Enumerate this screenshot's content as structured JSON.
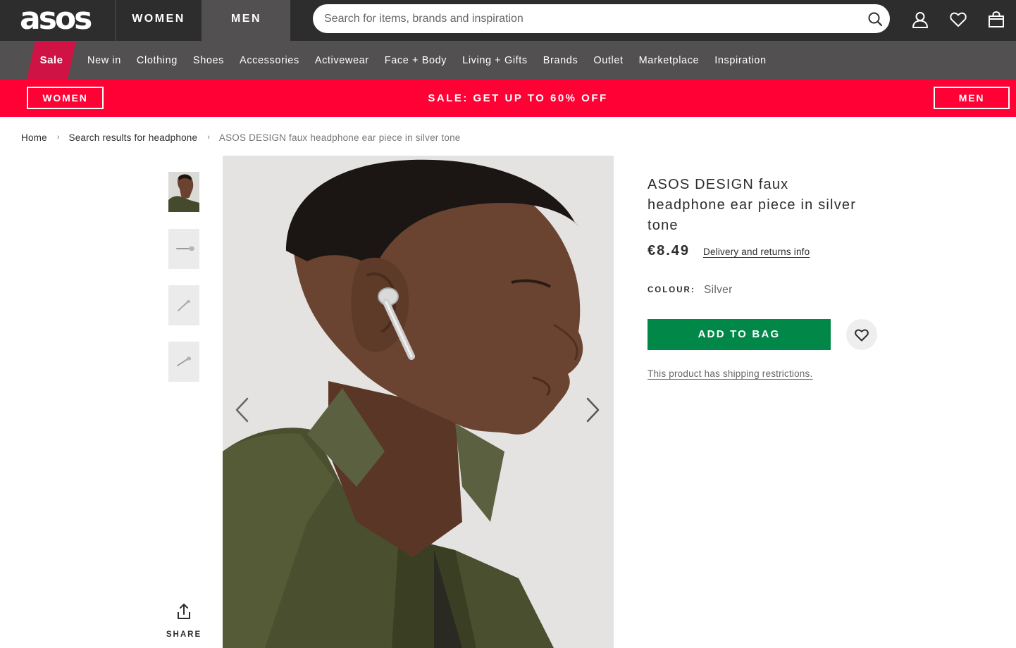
{
  "header": {
    "logo_text": "asos",
    "gender_tabs": [
      {
        "label": "WOMEN",
        "active": false
      },
      {
        "label": "MEN",
        "active": true
      }
    ],
    "search": {
      "placeholder": "Search for items, brands and inspiration",
      "value": ""
    },
    "icons": [
      "search-icon",
      "account-icon",
      "saved-items-heart-icon",
      "bag-icon"
    ]
  },
  "nav": {
    "sale_label": "Sale",
    "items": [
      "New in",
      "Clothing",
      "Shoes",
      "Accessories",
      "Activewear",
      "Face + Body",
      "Living + Gifts",
      "Brands",
      "Outlet",
      "Marketplace",
      "Inspiration"
    ]
  },
  "banner": {
    "women_label": "WOMEN",
    "text": "SALE: GET UP TO 60% OFF",
    "men_label": "MEN"
  },
  "breadcrumb": {
    "items": [
      "Home",
      "Search results for headphone"
    ],
    "current": "ASOS DESIGN faux headphone ear piece in silver tone",
    "separator": "›"
  },
  "gallery": {
    "thumbnail_count": 4,
    "share_label": "SHARE"
  },
  "product": {
    "title": "ASOS DESIGN faux headphone ear piece in silver tone",
    "price": "€8.49",
    "delivery_link": "Delivery and returns info",
    "colour_label": "COLOUR:",
    "colour_value": "Silver",
    "add_to_bag_label": "ADD TO BAG",
    "shipping_restriction": "This product has shipping restrictions."
  },
  "colors": {
    "header_bg": "#2d2d2d",
    "nav_bg": "#525050",
    "sale_tab": "#d01345",
    "banner_bg": "#ff0134",
    "add_to_bag": "#018849"
  }
}
